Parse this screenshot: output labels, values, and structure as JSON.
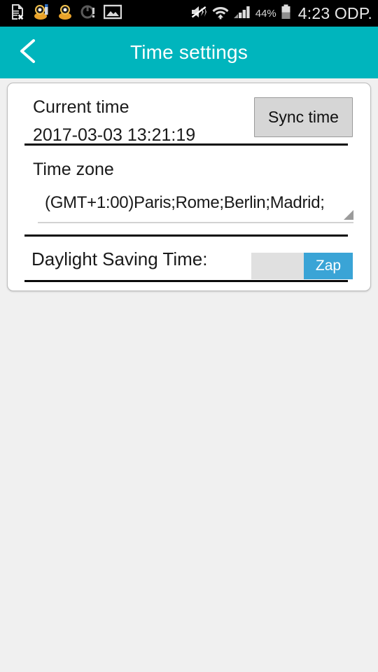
{
  "statusbar": {
    "left_icons": [
      {
        "name": "sd-card-removed-icon"
      },
      {
        "name": "app-notification-icon-1"
      },
      {
        "name": "app-notification-icon-2"
      },
      {
        "name": "sync-error-icon"
      },
      {
        "name": "gallery-image-icon"
      }
    ],
    "right_icons": [
      {
        "name": "mute-vibrate-off-icon"
      },
      {
        "name": "wifi-icon"
      },
      {
        "name": "cellular-signal-icon"
      }
    ],
    "battery_percent": "44%",
    "battery_icon": "battery-icon",
    "clock": "4:23 ODP."
  },
  "appbar": {
    "back_icon": "back-chevron-icon",
    "title": "Time settings",
    "background_color": "#00b5bd"
  },
  "card": {
    "current_time": {
      "label": "Current time",
      "value": "2017-03-03 13:21:19",
      "sync_button_label": "Sync time"
    },
    "time_zone": {
      "label": "Time zone",
      "selected_option": "(GMT+1:00)Paris;Rome;Berlin;Madrid;",
      "dropdown_icon": "dropdown-triangle-icon"
    },
    "daylight_saving": {
      "label": "Daylight Saving Time:",
      "toggle_label": "Zap",
      "toggle_color": "#3aa4d6"
    }
  }
}
